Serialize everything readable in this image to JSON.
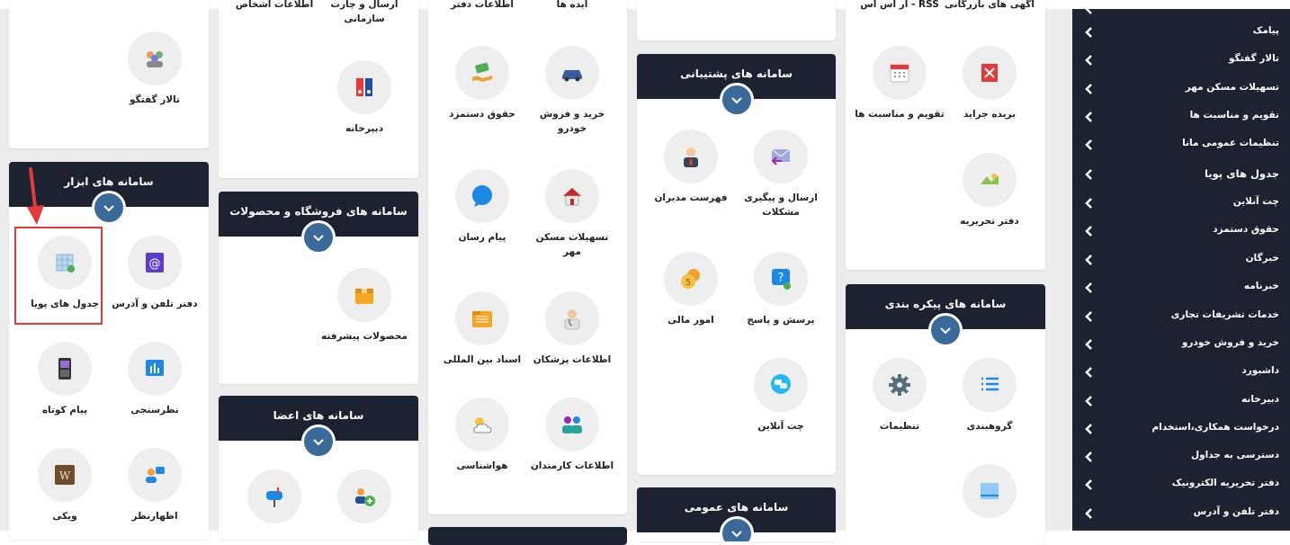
{
  "cards": {
    "c1": {
      "items": [
        "تالار گفتگو"
      ]
    },
    "tools": {
      "title": "سامانه های ابزار",
      "items": [
        "دفتر تلفن و آدرس",
        "جدول های پویا",
        "نظرسنجی",
        "پیام کوتاه",
        "اظهارنظر",
        "ویکی"
      ]
    },
    "c2": {
      "top_items": [
        "ارسال و چارت سازمانی",
        "اطلاعات اشخاص"
      ],
      "items": [
        "دبیرخانه"
      ]
    },
    "shop": {
      "title": "سامانه های فروشگاه و محصولات",
      "items": [
        "محصولات پیشرفته"
      ]
    },
    "members": {
      "title": "سامانه های اعضا"
    },
    "c3": {
      "top_items": [
        "ایده ها",
        "اطلاعات دفتر"
      ],
      "items": [
        "خرید و فروش خودرو",
        "حقوق دستمزد",
        "تسهیلات مسکن مهر",
        "پیام رسان",
        "اطلاعات پزشکان",
        "اسناد بین المللی",
        "اطلاعات کارمندان",
        "هواشناسی"
      ]
    },
    "support": {
      "title": "سامانه های پشتیبانی",
      "items": [
        "ارسال و پیگیری مشکلات",
        "فهرست مدیران",
        "پرسش و پاسخ",
        "امور مالی",
        "چت آنلاین"
      ]
    },
    "general": {
      "title": "سامانه های عمومی"
    },
    "c4": {
      "top_items": [
        "آگهی های بازرگانی",
        "آر اس اس - RSS"
      ],
      "items": [
        "بریده جراید",
        "تقویم و مناسبت ها",
        "دفتر تحریریه"
      ]
    },
    "config": {
      "title": "سامانه های پیکره بندی",
      "items": [
        "گروهبندی",
        "تنظیمات"
      ]
    }
  },
  "sidebar": {
    "items": [
      "پیامک",
      "تالار گفتگو",
      "تسهیلات مسکن مهر",
      "تقویم و مناسبت ها",
      "تنظیمات عمومی مانا",
      "جدول های پویا",
      "چت آنلاین",
      "حقوق دستمزد",
      "خبرگان",
      "خبرنامه",
      "خدمات تشریفات تجاری",
      "خرید و فروش خودرو",
      "داشبورد",
      "دبیرخانه",
      "درخواست همکاری،استخدام",
      "دسترسی به جداول",
      "دفتر تحریریه الکترونیک",
      "دفتر تلفن و آدرس"
    ]
  },
  "colors": {
    "header": "#1d2230",
    "accent": "#3a6a9a",
    "annotation": "#e5393a"
  }
}
